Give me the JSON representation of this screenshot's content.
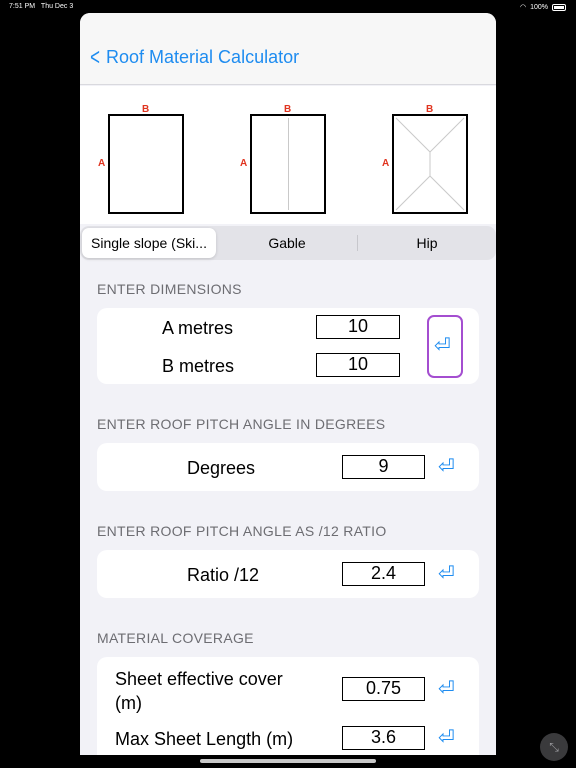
{
  "status": {
    "time": "7:51 PM",
    "date": "Thu Dec 3",
    "battery": "100%"
  },
  "nav": {
    "title": "Roof Material Calculator"
  },
  "diagram_labels": {
    "a": "A",
    "b": "B"
  },
  "segments": [
    {
      "label": "Single slope (Ski..."
    },
    {
      "label": "Gable"
    },
    {
      "label": "Hip"
    }
  ],
  "dimensions": {
    "header": "ENTER DIMENSIONS",
    "a_label": "A metres",
    "a_value": "10",
    "b_label": "B metres",
    "b_value": "10"
  },
  "degrees": {
    "header": "ENTER ROOF PITCH ANGLE IN DEGREES",
    "label": "Degrees",
    "value": "9"
  },
  "ratio": {
    "header": "ENTER ROOF PITCH ANGLE AS /12 RATIO",
    "label": "Ratio /12",
    "value": "2.4"
  },
  "coverage": {
    "header": "MATERIAL COVERAGE",
    "sheet_label_line1": "Sheet effective cover",
    "sheet_label_line2": "(m)",
    "sheet_value": "0.75",
    "max_label": "Max Sheet Length (m)",
    "max_value": "3.6"
  },
  "icons": {
    "enter": "return-arrow-icon",
    "back": "chevron-left-icon",
    "collapse": "collapse-icon"
  },
  "colors": {
    "accent": "#1e8cf0",
    "marker": "#e0341f",
    "focus": "#a44ed0"
  }
}
